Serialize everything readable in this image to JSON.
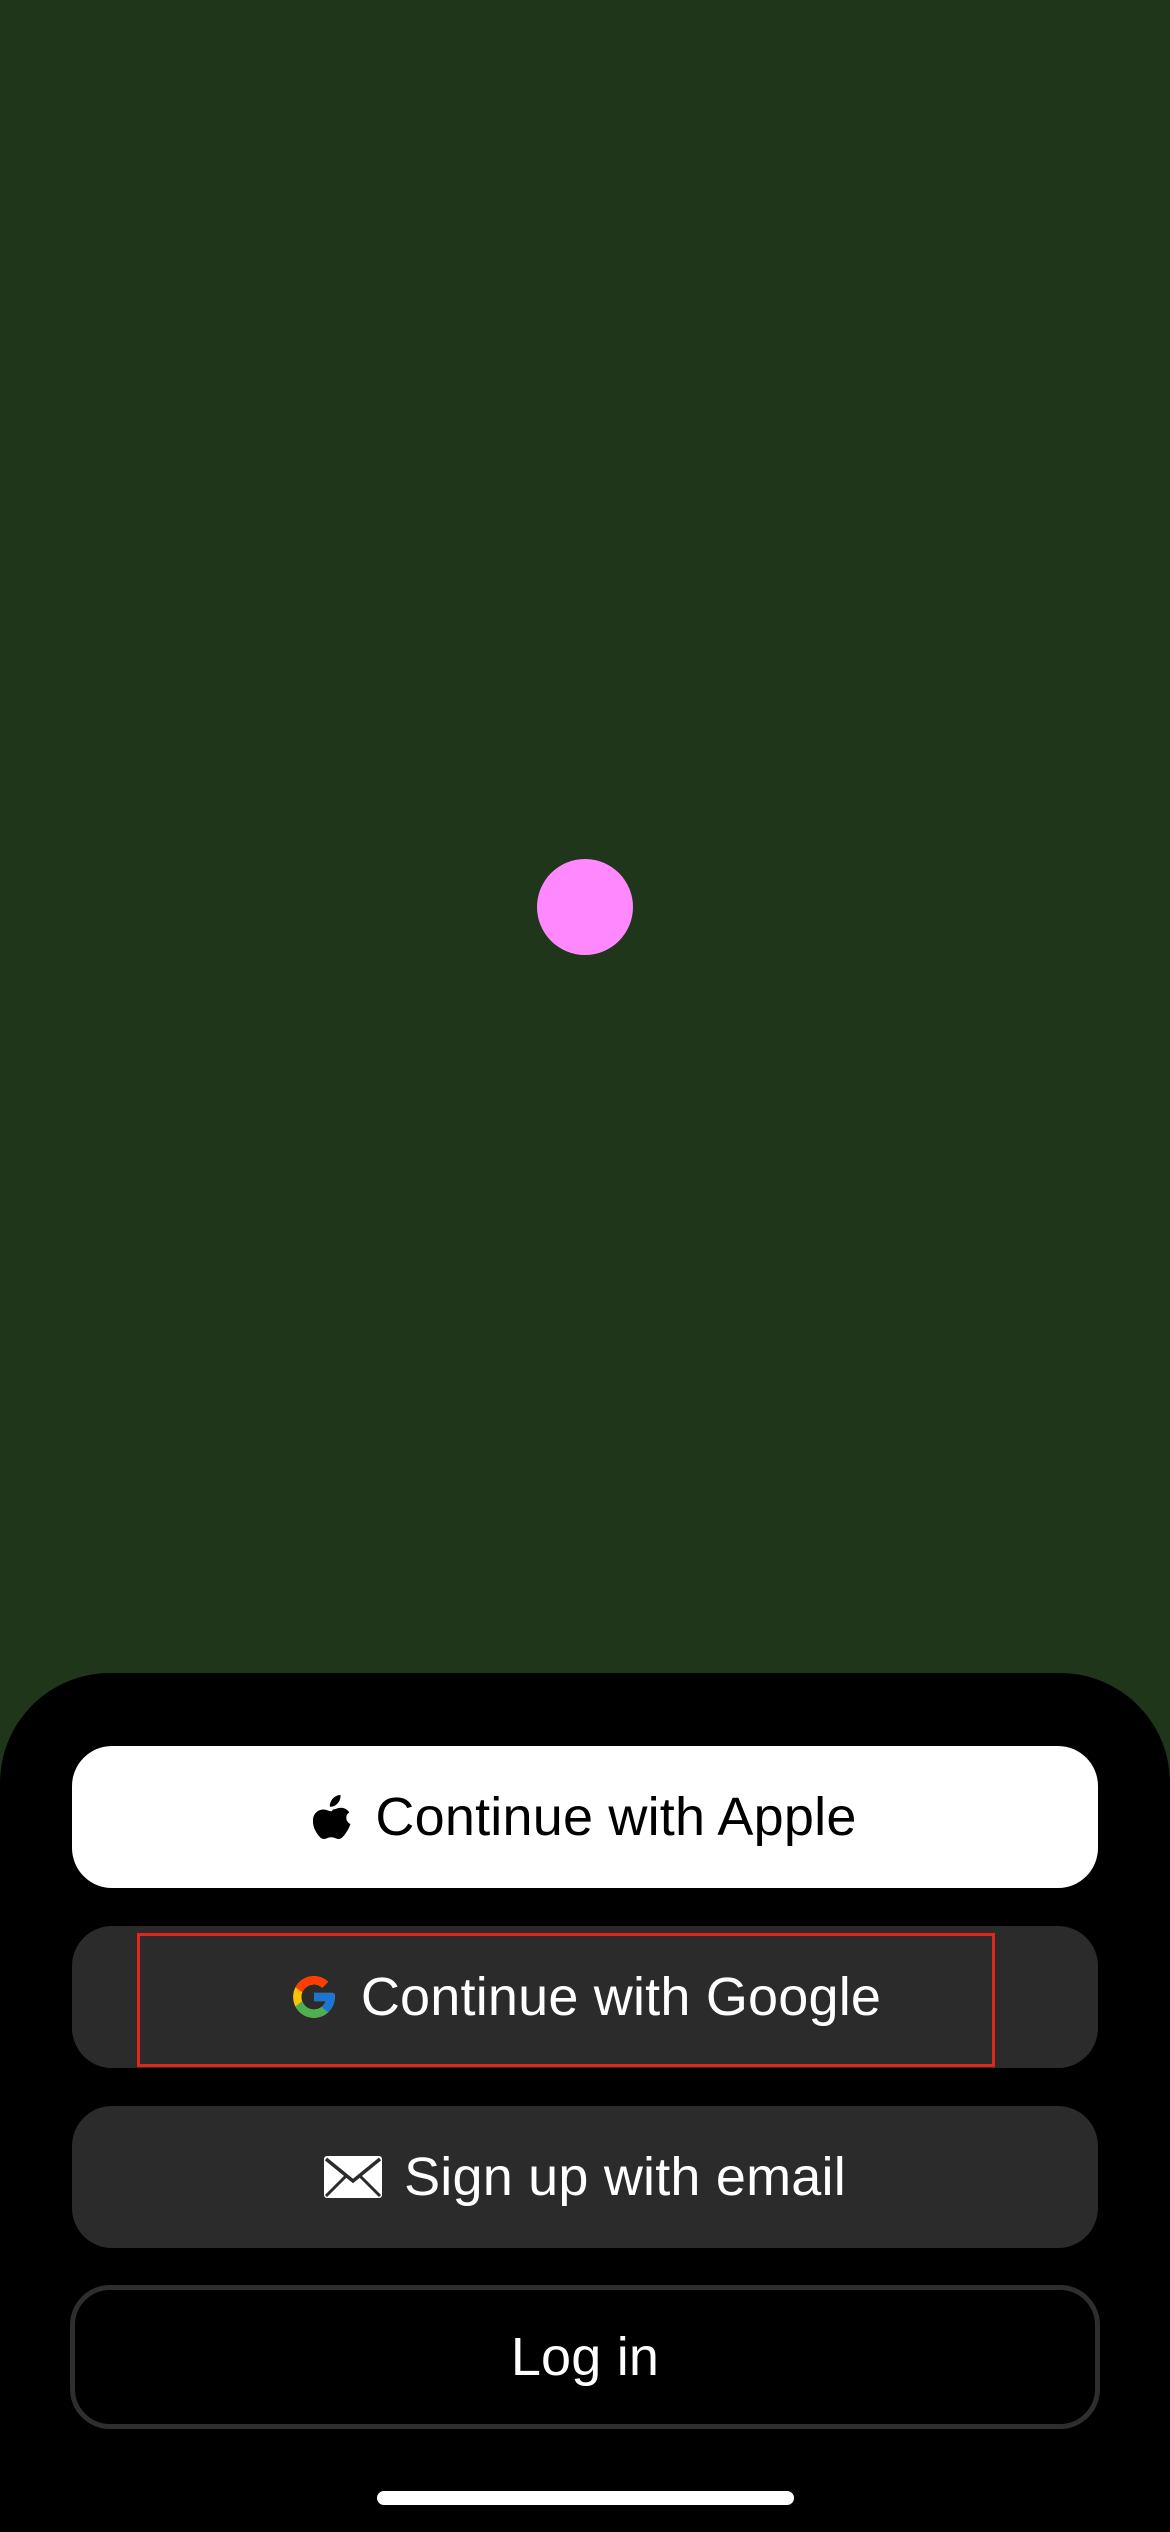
{
  "colors": {
    "background": "#1f361b",
    "dot": "#ff88ff",
    "sheet": "#000000",
    "highlight": "#e0261f"
  },
  "auth": {
    "apple": {
      "label": "Continue with Apple",
      "icon": "apple-icon"
    },
    "google": {
      "label": "Continue with Google",
      "icon": "google-icon"
    },
    "email": {
      "label": "Sign up with email",
      "icon": "envelope-icon"
    },
    "login": {
      "label": "Log in"
    }
  }
}
